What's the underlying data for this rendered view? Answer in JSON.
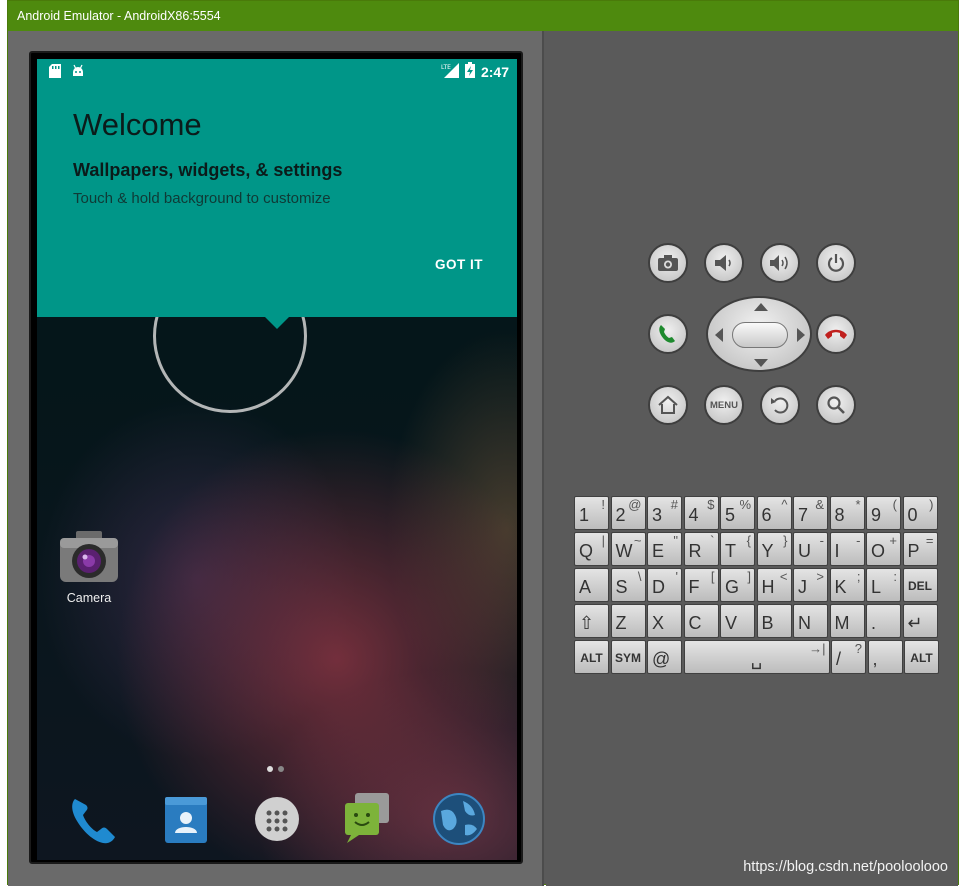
{
  "window": {
    "title": "Android Emulator - AndroidX86:5554"
  },
  "status_bar": {
    "time": "2:47",
    "network": "LTE"
  },
  "welcome": {
    "title": "Welcome",
    "subtitle": "Wallpapers, widgets, & settings",
    "description": "Touch & hold background to customize",
    "button": "GOT IT"
  },
  "home": {
    "apps": [
      {
        "label": "Camera",
        "icon": "camera-icon"
      }
    ],
    "dock": [
      "phone-icon",
      "contacts-icon",
      "app-drawer-icon",
      "messaging-icon",
      "browser-icon"
    ]
  },
  "hardware_buttons": {
    "row1": [
      "camera-icon",
      "volume-down-icon",
      "volume-up-icon",
      "power-icon"
    ],
    "row3": [
      "home-icon",
      "MENU",
      "back-icon",
      "search-icon"
    ]
  },
  "keyboard": {
    "row1": [
      [
        "1",
        "!"
      ],
      [
        "2",
        "@"
      ],
      [
        "3",
        "#"
      ],
      [
        "4",
        "$"
      ],
      [
        "5",
        "%"
      ],
      [
        "6",
        "^"
      ],
      [
        "7",
        "&"
      ],
      [
        "8",
        "*"
      ],
      [
        "9",
        "("
      ],
      [
        "0",
        ")"
      ]
    ],
    "row2": [
      [
        "Q",
        "|"
      ],
      [
        "W",
        "~"
      ],
      [
        "E",
        "\""
      ],
      [
        "R",
        "`"
      ],
      [
        "T",
        "{"
      ],
      [
        "Y",
        "}"
      ],
      [
        "U",
        "-"
      ],
      [
        "I",
        "-"
      ],
      [
        "O",
        "+"
      ],
      [
        "P",
        "="
      ]
    ],
    "row3": [
      [
        "A",
        ""
      ],
      [
        "S",
        "\\"
      ],
      [
        "D",
        "'"
      ],
      [
        "F",
        "["
      ],
      [
        "G",
        "]"
      ],
      [
        "H",
        "<"
      ],
      [
        "J",
        ">"
      ],
      [
        "K",
        ";"
      ],
      [
        "L",
        ":"
      ],
      [
        "DEL",
        ""
      ]
    ],
    "row4": [
      [
        "⇧",
        ""
      ],
      [
        "Z",
        ""
      ],
      [
        "X",
        ""
      ],
      [
        "C",
        ""
      ],
      [
        "V",
        ""
      ],
      [
        "B",
        ""
      ],
      [
        "N",
        ""
      ],
      [
        "M",
        ""
      ],
      [
        ".",
        ""
      ],
      [
        "↵",
        ""
      ]
    ],
    "row5": [
      [
        "ALT",
        ""
      ],
      [
        "SYM",
        ""
      ],
      [
        "@",
        ""
      ],
      [
        "␣",
        "→|"
      ],
      [
        "/",
        "?"
      ],
      [
        ",",
        ""
      ],
      [
        "ALT",
        ""
      ]
    ]
  },
  "watermark": "https://blog.csdn.net/pooloolooo",
  "colors": {
    "titlebar": "#4e8a0e",
    "welcome_card": "#009688"
  }
}
